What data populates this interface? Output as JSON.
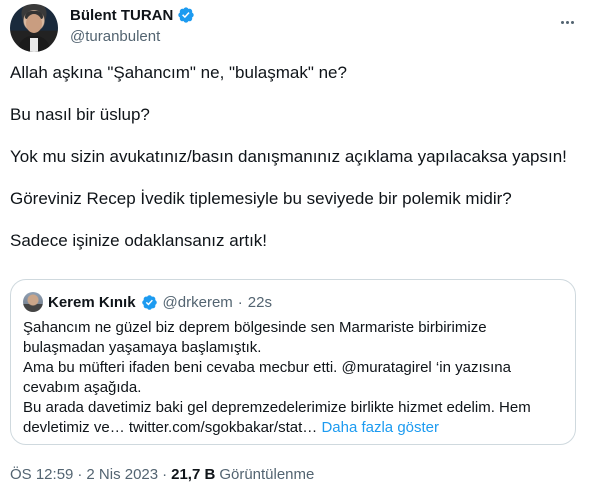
{
  "author": {
    "display_name": "Bülent TURAN",
    "handle": "@turanbulent",
    "verified": true
  },
  "tweet": {
    "paragraphs": [
      "Allah aşkına \"Şahancım\" ne, \"bulaşmak\" ne?",
      "Bu nasıl bir üslup?",
      "Yok mu sizin avukatınız/basın danışmanınız açıklama yapılacaksa yapsın!",
      "Göreviniz Recep İvedik tiplemesiyle bu seviyede bir polemik midir?",
      "Sadece işinize odaklansanız artık!"
    ]
  },
  "quoted_tweet": {
    "display_name": "Kerem Kınık",
    "handle": "@drkerem",
    "separator": "·",
    "time": "22s",
    "lines": [
      "Şahancım ne güzel biz deprem bölgesinde sen Marmariste birbirimize",
      "bulaşmadan yaşamaya başlamıştık.",
      "Ama bu müfteri ifaden beni cevaba mecbur etti. @muratagirel ‘in yazısına",
      "cevabım aşağıda.",
      "Bu arada davetimiz baki gel depremzedelerimize birlikte hizmet edelim. Hem",
      "devletimiz ve… twitter.com/sgokbakar/stat…"
    ],
    "show_more": "Daha fazla göster"
  },
  "meta": {
    "time": "ÖS 12:59",
    "separator": "·",
    "date": "2 Nis 2023",
    "views_count": "21,7 B",
    "views_label": "Görüntülenme"
  },
  "colors": {
    "verified": "#1d9bf0",
    "link": "#1d9bf0",
    "secondary_text": "#536471",
    "border": "#cfd9de"
  },
  "icons": [
    "verified-badge-icon",
    "more-options-icon"
  ]
}
